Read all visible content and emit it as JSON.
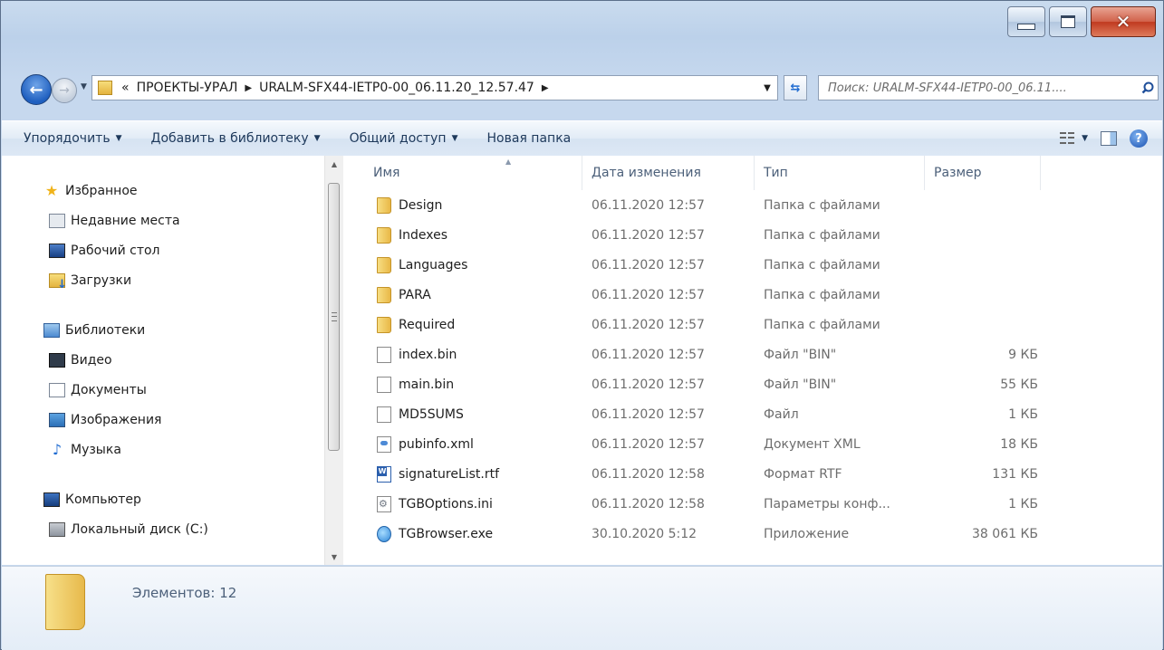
{
  "window": {
    "caption_buttons": {
      "minimize": "minimize-icon",
      "maximize": "maximize-icon",
      "close": "close-icon"
    }
  },
  "address": {
    "overflow": "«",
    "segments": [
      "ПРОЕКТЫ-УРАЛ",
      "URALM-SFX44-IETP0-00_06.11.20_12.57.47"
    ]
  },
  "search": {
    "placeholder": "Поиск: URALM-SFX44-IETP0-00_06.11...."
  },
  "toolbar": {
    "organize": "Упорядочить",
    "add_library": "Добавить в библиотеку",
    "share": "Общий доступ",
    "new_folder": "Новая папка"
  },
  "navpane": {
    "favorites": {
      "label": "Избранное",
      "items": [
        "Недавние места",
        "Рабочий стол",
        "Загрузки"
      ]
    },
    "libraries": {
      "label": "Библиотеки",
      "items": [
        "Видео",
        "Документы",
        "Изображения",
        "Музыка"
      ]
    },
    "computer": {
      "label": "Компьютер",
      "items": [
        "Локальный диск (C:)"
      ]
    }
  },
  "columns": {
    "name": "Имя",
    "date": "Дата изменения",
    "type": "Тип",
    "size": "Размер"
  },
  "files": [
    {
      "name": "Design",
      "date": "06.11.2020 12:57",
      "type": "Папка с файлами",
      "size": "",
      "icon": "folder"
    },
    {
      "name": "Indexes",
      "date": "06.11.2020 12:57",
      "type": "Папка с файлами",
      "size": "",
      "icon": "folder"
    },
    {
      "name": "Languages",
      "date": "06.11.2020 12:57",
      "type": "Папка с файлами",
      "size": "",
      "icon": "folder"
    },
    {
      "name": "PARA",
      "date": "06.11.2020 12:57",
      "type": "Папка с файлами",
      "size": "",
      "icon": "folder"
    },
    {
      "name": "Required",
      "date": "06.11.2020 12:57",
      "type": "Папка с файлами",
      "size": "",
      "icon": "folder"
    },
    {
      "name": "index.bin",
      "date": "06.11.2020 12:57",
      "type": "Файл \"BIN\"",
      "size": "9 КБ",
      "icon": "file"
    },
    {
      "name": "main.bin",
      "date": "06.11.2020 12:57",
      "type": "Файл \"BIN\"",
      "size": "55 КБ",
      "icon": "file"
    },
    {
      "name": "MD5SUMS",
      "date": "06.11.2020 12:57",
      "type": "Файл",
      "size": "1 КБ",
      "icon": "file"
    },
    {
      "name": "pubinfo.xml",
      "date": "06.11.2020 12:57",
      "type": "Документ XML",
      "size": "18 КБ",
      "icon": "xml"
    },
    {
      "name": "signatureList.rtf",
      "date": "06.11.2020 12:58",
      "type": "Формат RTF",
      "size": "131 КБ",
      "icon": "rtf"
    },
    {
      "name": "TGBOptions.ini",
      "date": "06.11.2020 12:58",
      "type": "Параметры конф...",
      "size": "1 КБ",
      "icon": "ini"
    },
    {
      "name": "TGBrowser.exe",
      "date": "30.10.2020 5:12",
      "type": "Приложение",
      "size": "38 061 КБ",
      "icon": "exe"
    }
  ],
  "details": {
    "items_count": "Элементов: 12"
  }
}
